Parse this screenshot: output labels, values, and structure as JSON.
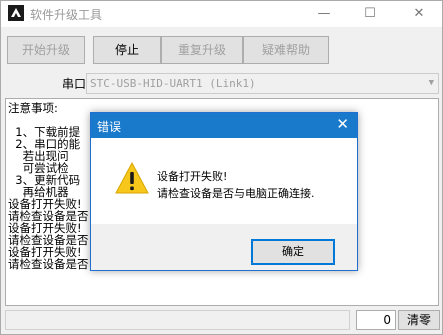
{
  "window": {
    "title": "软件升级工具",
    "icon": "app-icon",
    "controls": {
      "minimize": "—",
      "maximize": "☐",
      "close": "✕"
    }
  },
  "toolbar": {
    "start_label": "开始升级",
    "stop_label": "停止",
    "restart_label": "重复升级",
    "help_label": "疑难帮助"
  },
  "port": {
    "label": "串口",
    "value": "STC-USB-HID-UART1 (Link1)"
  },
  "log": {
    "lines": [
      "注意事项:",
      "  1、下载前提",
      "  2、串口的能",
      "    若出现问",
      "    可尝试检",
      "  3、更新代码",
      "    再给机器",
      "设备打开失败!",
      "请检查设备是否",
      "设备打开失败!",
      "请检查设备是否",
      "设备打开失败!",
      "请检查设备是否"
    ]
  },
  "status": {
    "count": "0",
    "clear_label": "清零"
  },
  "dialog": {
    "title": "错误",
    "close": "✕",
    "message_line1": "设备打开失败!",
    "message_line2": "请检查设备是否与电脑正确连接.",
    "ok_label": "确定",
    "icon": "warning-icon",
    "accent": "#1979ca"
  }
}
